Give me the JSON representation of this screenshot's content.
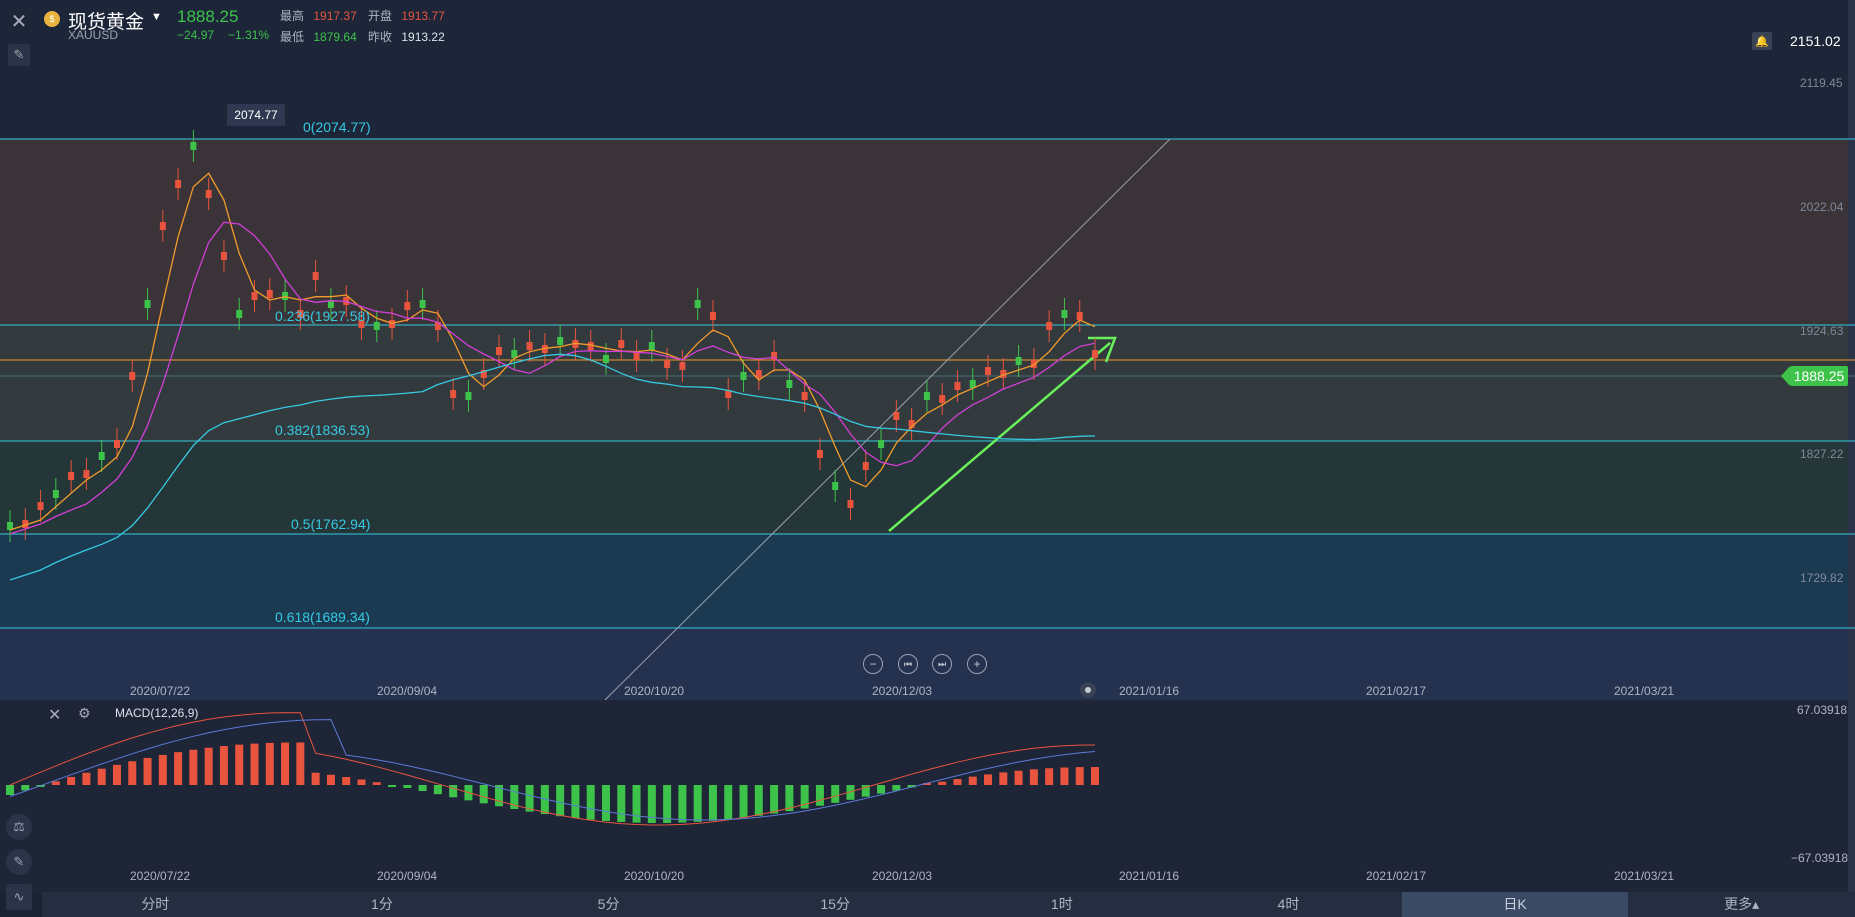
{
  "header": {
    "title": "现货黄金",
    "symbol": "XAUUSD",
    "price": "1888.25",
    "change": "−24.97",
    "change_pct": "−1.31%",
    "high_label": "最高",
    "high": "1917.37",
    "open_label": "开盘",
    "open": "1913.77",
    "low_label": "最低",
    "low": "1879.64",
    "prev_label": "昨收",
    "prev": "1913.22"
  },
  "chart": {
    "top_value": "2151.02",
    "current_price": "1888.25",
    "y_labels": [
      "2119.45",
      "2022.04",
      "1924.63",
      "1827.22",
      "1729.82"
    ],
    "peak_tooltip": "2074.77",
    "fib_levels": [
      "0(2074.77)",
      "0.236(1927.58)",
      "0.382(1836.53)",
      "0.5(1762.94)",
      "0.618(1689.34)"
    ],
    "dates": [
      "2020/07/22",
      "2020/09/04",
      "2020/10/20",
      "2020/12/03",
      "2021/01/16",
      "2021/02/17",
      "2021/03/21"
    ],
    "colors": {
      "up": "#e8543e",
      "down": "#3dc24a",
      "fib": "#36c9e2",
      "ma5": "#f29b2c",
      "ma10": "#d23fd6",
      "ma60": "#36c9e2",
      "price_line": "#f29b2c",
      "trend": "#69f05a"
    }
  },
  "nav": {
    "zoom_out": "−",
    "prev": "⏮",
    "next": "⏭",
    "zoom_in": "+"
  },
  "macd": {
    "title": "MACD(12,26,9)",
    "top": "67.03918",
    "bottom": "−67.03918"
  },
  "tabs": [
    "分时",
    "1分",
    "5分",
    "15分",
    "1时",
    "4时",
    "日K",
    "更多▴"
  ],
  "active_tab": "日K"
}
